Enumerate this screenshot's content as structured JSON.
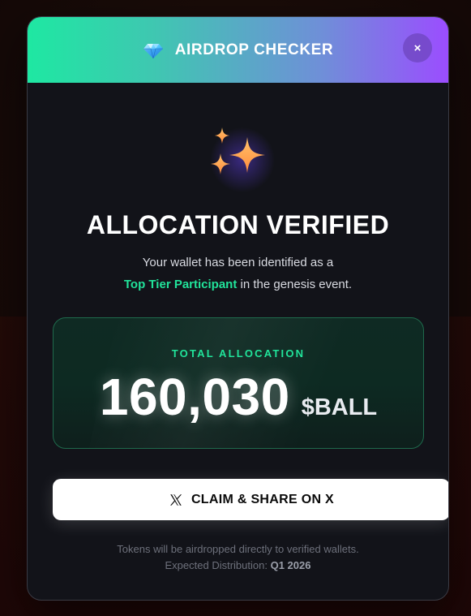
{
  "modal": {
    "title": "AIRDROP CHECKER",
    "close_label": "×",
    "heading": "ALLOCATION VERIFIED",
    "description": {
      "line1": "Your wallet has been identified as a",
      "highlight": "Top Tier Participant",
      "line2_rest": " in the genesis event."
    },
    "allocation": {
      "label": "TOTAL ALLOCATION",
      "amount": "160,030",
      "token": "$BALL"
    },
    "claim_button_label": "CLAIM & SHARE ON X",
    "footer": {
      "line1": "Tokens will be airdropped directly to verified wallets.",
      "line2_prefix": "Expected Distribution: ",
      "line2_value": "Q1 2026"
    }
  },
  "colors": {
    "accent_green": "#21e39a",
    "header_gradient_start": "#1ee8a2",
    "header_gradient_end": "#9b4dff",
    "modal_bg": "#121319"
  },
  "icons": {
    "header": "gem-icon",
    "close": "close-icon",
    "hero": "sparkles-icon",
    "claim": "x-logo-icon"
  }
}
